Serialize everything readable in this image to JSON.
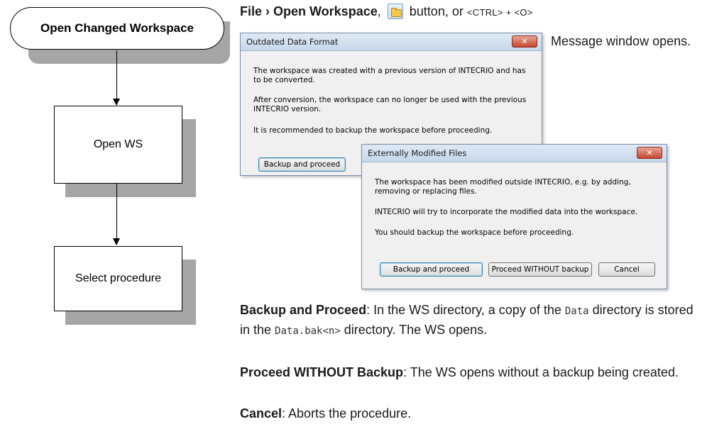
{
  "flowchart": {
    "start_label": "Open Changed Workspace",
    "step1_label": "Open WS",
    "step2_label": "Select procedure"
  },
  "instruction": {
    "menu_path": "File › Open Workspace",
    "comma": ",",
    "button_word": "button, or",
    "shortcut": "<CTRL> + <O>",
    "icon": "open-folder-icon"
  },
  "message_note": "Message window opens.",
  "dialog_outdated": {
    "title": "Outdated Data Format",
    "close_glyph": "✕",
    "para1": "The workspace was created with a previous version of INTECRIO and has to be converted.",
    "para2": "After conversion, the workspace can no longer be used with the previous INTECRIO version.",
    "para3": "It is recommended to backup the workspace before proceeding.",
    "backup_button": "Backup and proceed"
  },
  "dialog_modified": {
    "title": "Externally Modified Files",
    "close_glyph": "✕",
    "para1": "The workspace has been modified outside INTECRIO, e.g. by adding, removing or replacing files.",
    "para2": "INTECRIO will try to incorporate the modified data into the workspace.",
    "para3": "You should backup the workspace before proceeding.",
    "backup_button": "Backup and proceed",
    "proceed_button": "Proceed WITHOUT backup",
    "cancel_button": "Cancel"
  },
  "options": {
    "backup_term": "Backup and Proceed",
    "backup_text_a": ": In the WS directory, a copy of the ",
    "backup_code1": "Data",
    "backup_text_b": " directory is stored in the ",
    "backup_code2": "Data.bak<n>",
    "backup_text_c": " directory. The WS opens.",
    "proceed_term": "Proceed WITHOUT Backup",
    "proceed_text": ": The WS opens without a backup being created.",
    "cancel_term": "Cancel",
    "cancel_text": ": Aborts the procedure."
  },
  "colors": {
    "shadow": "#a6a6a6",
    "dialog_bg": "#f0f0f0",
    "close_red": "#c7462e"
  }
}
